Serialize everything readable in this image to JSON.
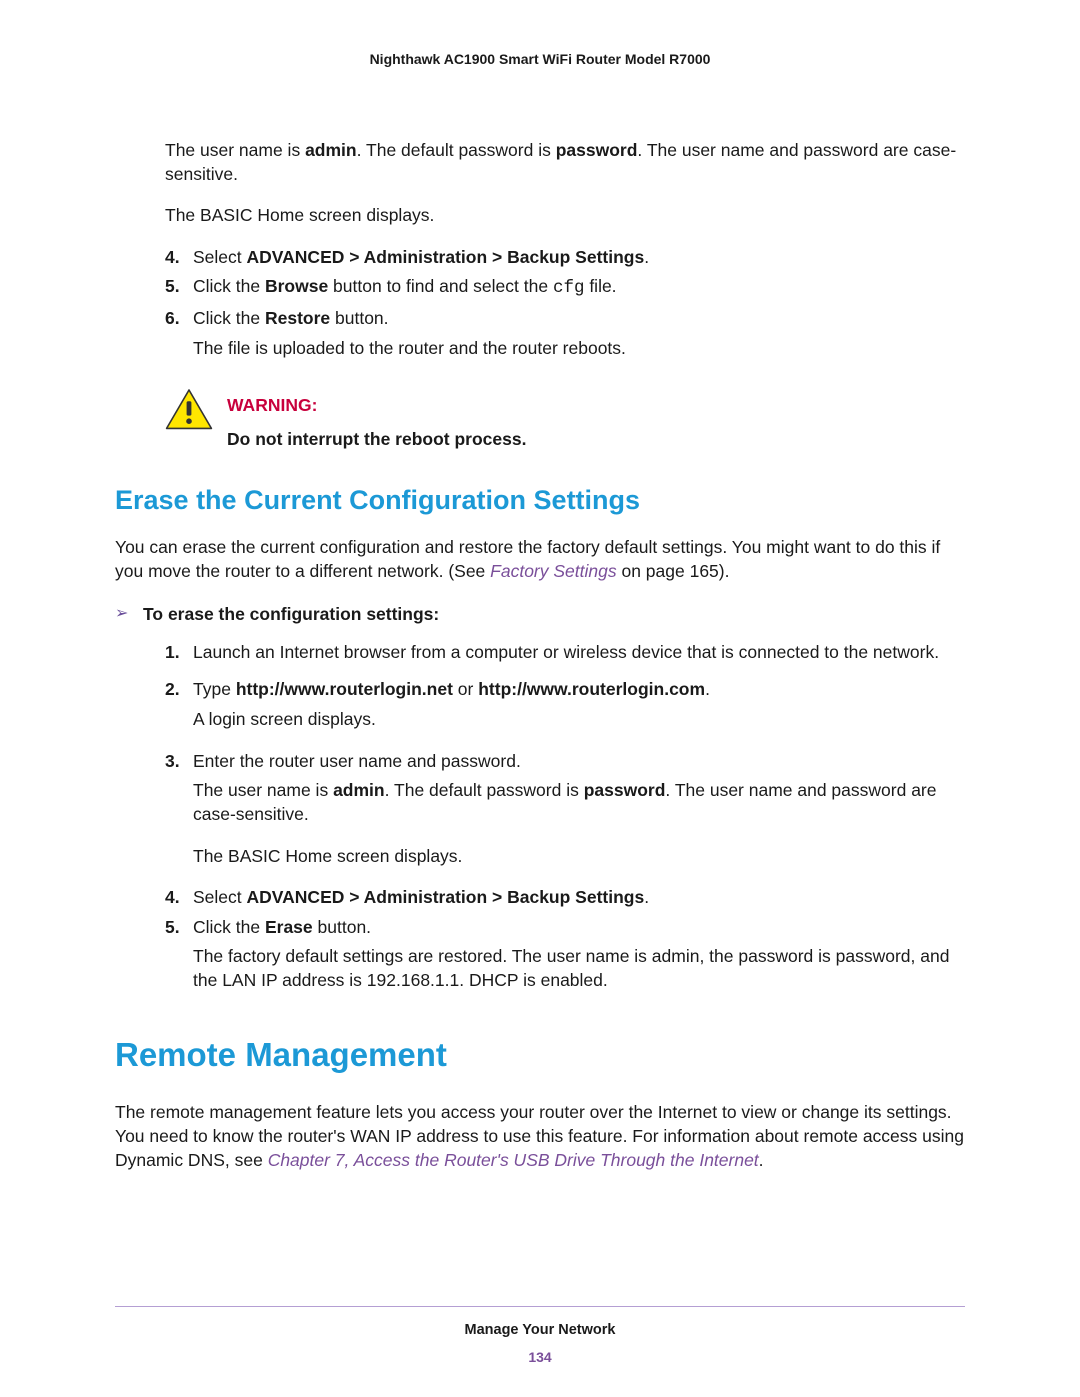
{
  "doc_header": "Nighthawk AC1900 Smart WiFi Router Model R7000",
  "intro": {
    "p1_a": "The user name is ",
    "p1_b": "admin",
    "p1_c": ". The default password is ",
    "p1_d": "password",
    "p1_e": ". The user name and password are case-sensitive.",
    "p2": "The BASIC Home screen displays."
  },
  "steps_a": {
    "n4": "4.",
    "s4_a": "Select ",
    "s4_b": "ADVANCED > Administration > Backup Settings",
    "s4_c": ".",
    "n5": "5.",
    "s5_a": "Click the ",
    "s5_b": "Browse",
    "s5_c": " button to find and select the ",
    "s5_d": "cfg",
    "s5_e": " file.",
    "n6": "6.",
    "s6_a": "Click the ",
    "s6_b": "Restore",
    "s6_c": " button.",
    "s6_sub": "The file is uploaded to the router and the router reboots."
  },
  "warning": {
    "label": "WARNING:",
    "text": "Do not interrupt the reboot process."
  },
  "h2_erase": "Erase the Current Configuration Settings",
  "erase_intro_a": "You can erase the current configuration and restore the factory default settings. You might want to do this if you move the router to a different network. (See ",
  "erase_intro_link": "Factory Settings",
  "erase_intro_b": " on page 165).",
  "task_chevron": "➢",
  "task_title": "To erase the configuration settings:",
  "steps_b": {
    "n1": "1.",
    "s1": "Launch an Internet browser from a computer or wireless device that is connected to the network.",
    "n2": "2.",
    "s2_a": "Type ",
    "s2_b": "http://www.routerlogin.net",
    "s2_c": " or ",
    "s2_d": "http://www.routerlogin.com",
    "s2_e": ".",
    "s2_sub": "A login screen displays.",
    "n3": "3.",
    "s3": "Enter the router user name and password.",
    "s3_sub1_a": "The user name is ",
    "s3_sub1_b": "admin",
    "s3_sub1_c": ". The default password is ",
    "s3_sub1_d": "password",
    "s3_sub1_e": ". The user name and password are case-sensitive.",
    "s3_sub2": "The BASIC Home screen displays.",
    "n4": "4.",
    "s4_a": "Select ",
    "s4_b": "ADVANCED > Administration > Backup Settings",
    "s4_c": ".",
    "n5": "5.",
    "s5_a": "Click the ",
    "s5_b": "Erase",
    "s5_c": " button.",
    "s5_sub": "The factory default settings are restored. The user name is admin, the password is password, and the LAN IP address is 192.168.1.1. DHCP is enabled."
  },
  "h1_remote": "Remote Management",
  "remote_p_a": "The remote management feature lets you access your router over the Internet to view or change its settings. You need to know the router's WAN IP address to use this feature. For information about remote access using Dynamic DNS, see ",
  "remote_p_link": "Chapter 7, Access the Router's USB Drive Through the Internet",
  "remote_p_b": ".",
  "footer": {
    "title": "Manage Your Network",
    "page": "134"
  }
}
